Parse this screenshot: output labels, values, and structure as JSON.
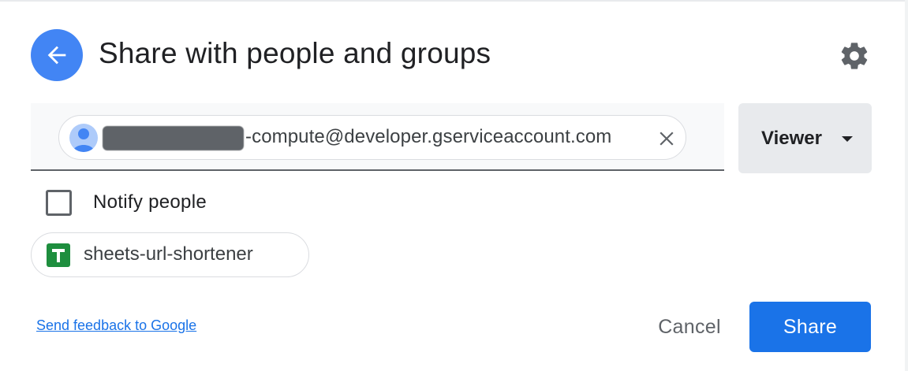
{
  "dialog": {
    "title": "Share with people and groups",
    "back_icon": "arrow-left-icon",
    "settings_icon": "gear-icon"
  },
  "recipient": {
    "email_suffix": "-compute@developer.gserviceaccount.com",
    "avatar_icon": "person-icon",
    "remove_icon": "close-icon"
  },
  "role": {
    "selected": "Viewer",
    "caret_icon": "caret-down-icon"
  },
  "notify": {
    "label": "Notify people",
    "checked": false
  },
  "file": {
    "name": "sheets-url-shortener",
    "icon": "google-sheets-icon"
  },
  "footer": {
    "feedback_link": "Send feedback to Google",
    "cancel_label": "Cancel",
    "share_label": "Share"
  },
  "colors": {
    "accent": "#1a73e8",
    "back_button": "#4285f4",
    "sheets_green": "#1e8e3e"
  }
}
